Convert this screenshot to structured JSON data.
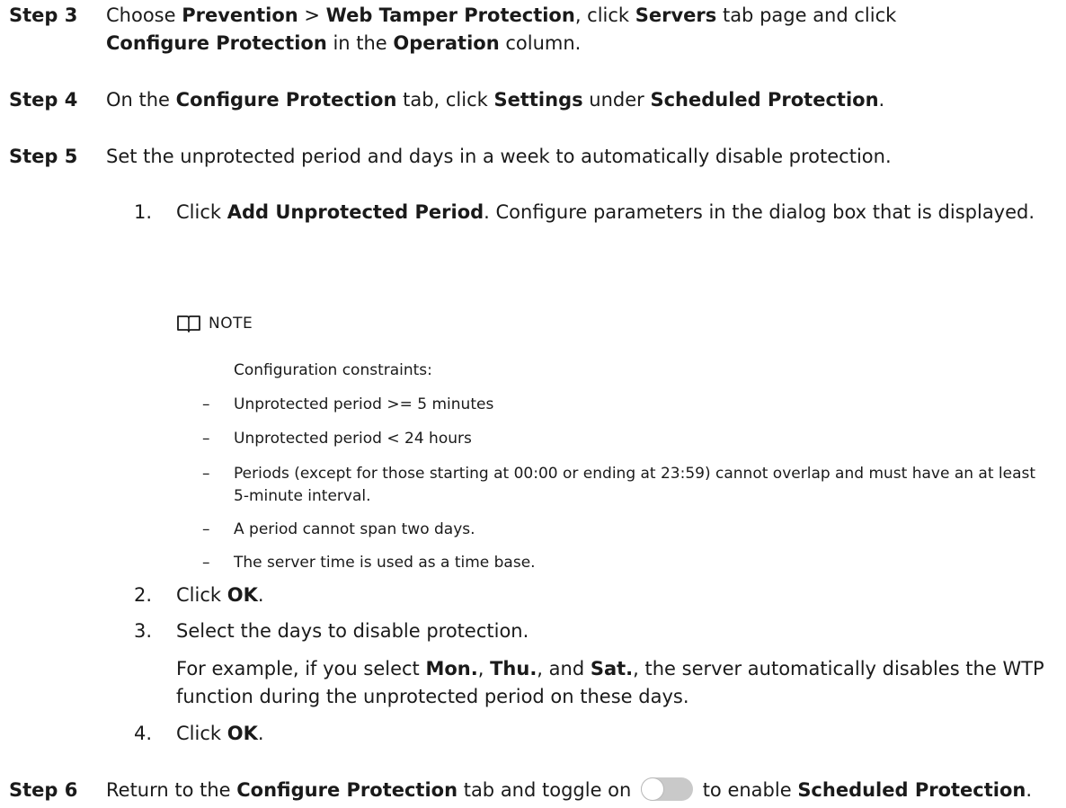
{
  "step3": {
    "label": "Step 3",
    "t1": "Choose ",
    "b1": "Prevention",
    "t2": " > ",
    "b2": "Web Tamper Protection",
    "t3": ", click ",
    "b3": "Servers",
    "t4": " tab page and click ",
    "b4": "Configure Protection",
    "t5": " in the ",
    "b5": "Operation",
    "t6": " column."
  },
  "step4": {
    "label": "Step 4",
    "t1": "On the ",
    "b1": "Configure Protection",
    "t2": " tab, click ",
    "b2": "Settings",
    "t3": " under ",
    "b3": "Scheduled Protection",
    "t4": "."
  },
  "step5": {
    "label": "Step 5",
    "text": "Set the unprotected period and days in a week to automatically disable protection.",
    "items": [
      {
        "num": "1.",
        "t1": "Click ",
        "b1": "Add Unprotected Period",
        "t2": ". Configure parameters in the dialog box that is displayed."
      },
      {
        "num": "2.",
        "t1": "Click ",
        "b1": "OK",
        "t2": "."
      },
      {
        "num": "3.",
        "text": "Select the days to disable protection.",
        "e1": "For example, if you select ",
        "eb1": "Mon.",
        "e2": ", ",
        "eb2": "Thu.",
        "e3": ", and ",
        "eb3": "Sat.",
        "e4": ", the server automatically disables the WTP function during the unprotected period on these days."
      },
      {
        "num": "4.",
        "t1": "Click ",
        "b1": "OK",
        "t2": "."
      }
    ]
  },
  "note": {
    "icon": "book-icon",
    "title": "NOTE",
    "intro": "Configuration constraints:",
    "bullets": [
      "Unprotected period >= 5 minutes",
      "Unprotected period < 24 hours",
      "Periods (except for those starting at 00:00 or ending at 23:59) cannot overlap and must have an at least 5-minute interval.",
      "A period cannot span two days.",
      "The server time is used as a time base."
    ],
    "dash": "–"
  },
  "step6": {
    "label": "Step 6",
    "t1": "Return to the ",
    "b1": "Configure Protection",
    "t2": " tab and toggle on ",
    "t3": " to enable ",
    "b2": "Scheduled Protection",
    "t4": "."
  },
  "colors": {
    "text": "#1a1a1a",
    "toggle_track": "#c9c9c9",
    "toggle_knob": "#ffffff"
  }
}
